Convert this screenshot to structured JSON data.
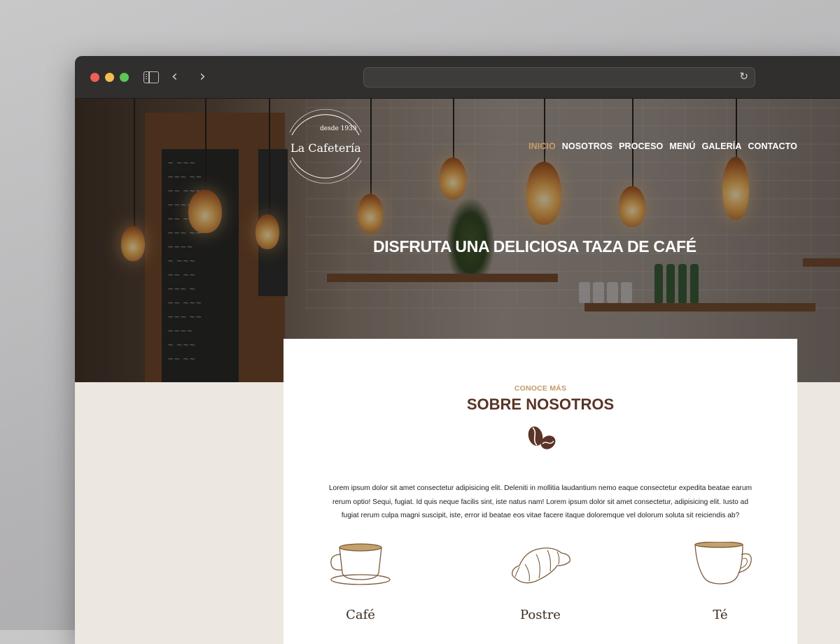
{
  "browser": {
    "url": ""
  },
  "logo": {
    "since": "desde 1939",
    "name": "La Cafetería"
  },
  "nav": {
    "items": [
      "INICIO",
      "NOSOTROS",
      "PROCESO",
      "MENÚ",
      "GALERÍA",
      "CONTACTO"
    ],
    "active_index": 0
  },
  "hero": {
    "title": "DISFRUTA UNA DELICIOSA TAZA DE CAFÉ"
  },
  "about": {
    "eyebrow": "CONOCE MÁS",
    "title": "SOBRE NOSOTROS",
    "body": "Lorem ipsum dolor sit amet consectetur adipisicing elit. Deleniti in mollitia laudantium nemo eaque consectetur expedita beatae earum rerum optio! Sequi, fugiat. Id quis neque facilis sint, iste natus nam! Lorem ipsum dolor sit amet consectetur, adipisicing elit. Iusto ad fugiat rerum culpa magni suscipit, iste, error id beatae eos vitae facere itaque doloremque vel dolorum soluta sit reiciendis ab?",
    "features": [
      {
        "label": "Café",
        "icon": "coffee-cup-icon"
      },
      {
        "label": "Postre",
        "icon": "croissant-icon"
      },
      {
        "label": "Té",
        "icon": "tea-cup-icon"
      }
    ]
  },
  "colors": {
    "accent": "#c99d66",
    "title": "#5a3426",
    "section_bg": "#ece7e0"
  }
}
